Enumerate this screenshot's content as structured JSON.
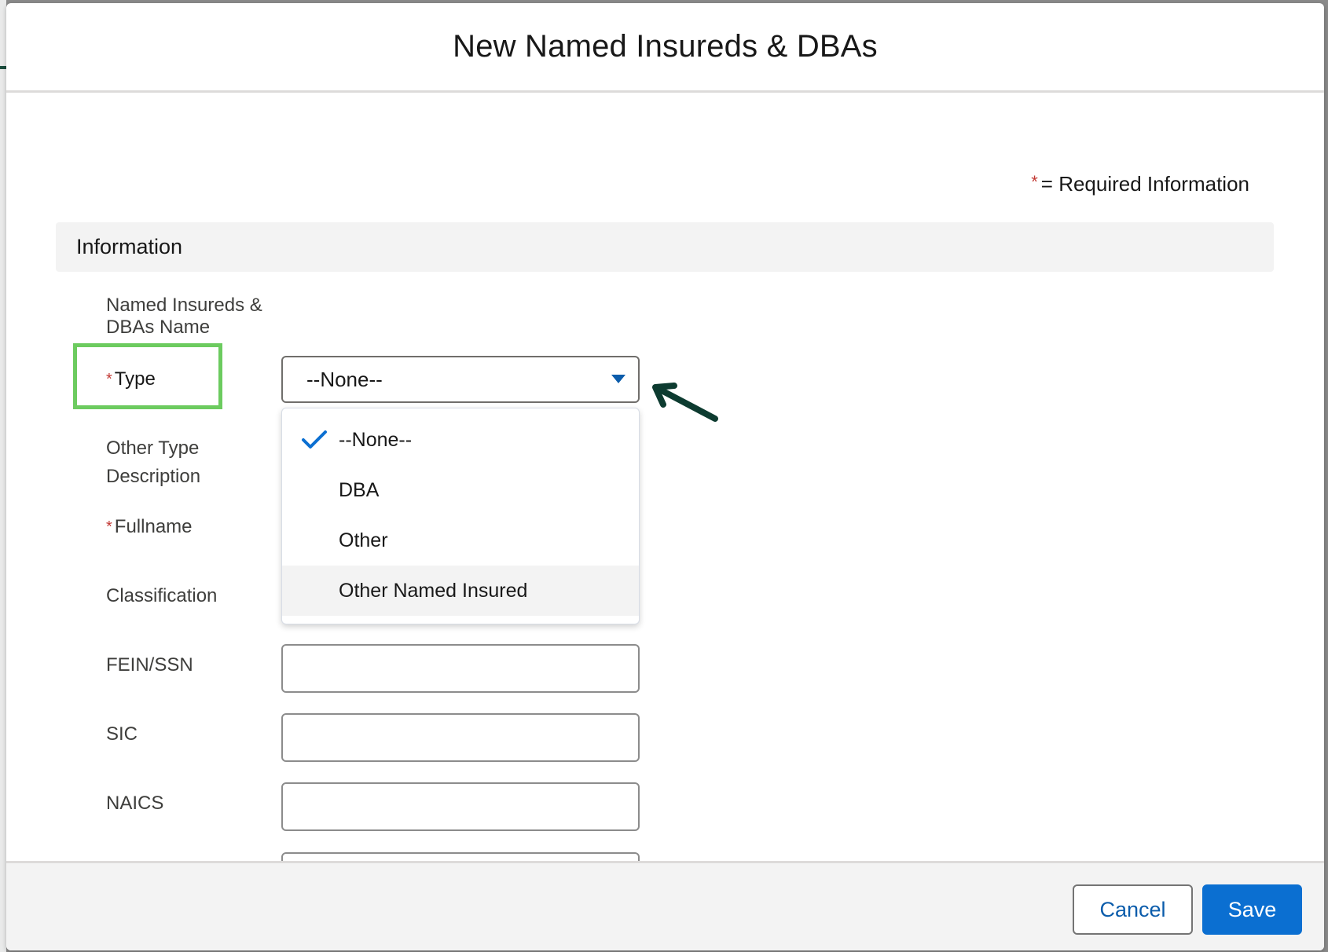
{
  "modal": {
    "title": "New Named Insureds & DBAs"
  },
  "form": {
    "required_star": "*",
    "required_legend": "= Required Information",
    "section_title": "Information",
    "labels": {
      "name": "Named Insureds & DBAs Name",
      "type": "Type",
      "other_type": "Other Type Description",
      "fullname": "Fullname",
      "classification": "Classification",
      "fein": "FEIN/SSN",
      "sic": "SIC",
      "naics": "NAICS"
    },
    "type_select": {
      "value": "--None--",
      "options": [
        "--None--",
        "DBA",
        "Other",
        "Other Named Insured"
      ],
      "selected_index": 0,
      "hovered_index": 3
    }
  },
  "footer": {
    "cancel_label": "Cancel",
    "save_label": "Save"
  },
  "colors": {
    "accent": "#0b6fd1",
    "required": "#c23934",
    "highlight": "#6ccb5f",
    "annotation_arrow": "#0d3b30"
  }
}
